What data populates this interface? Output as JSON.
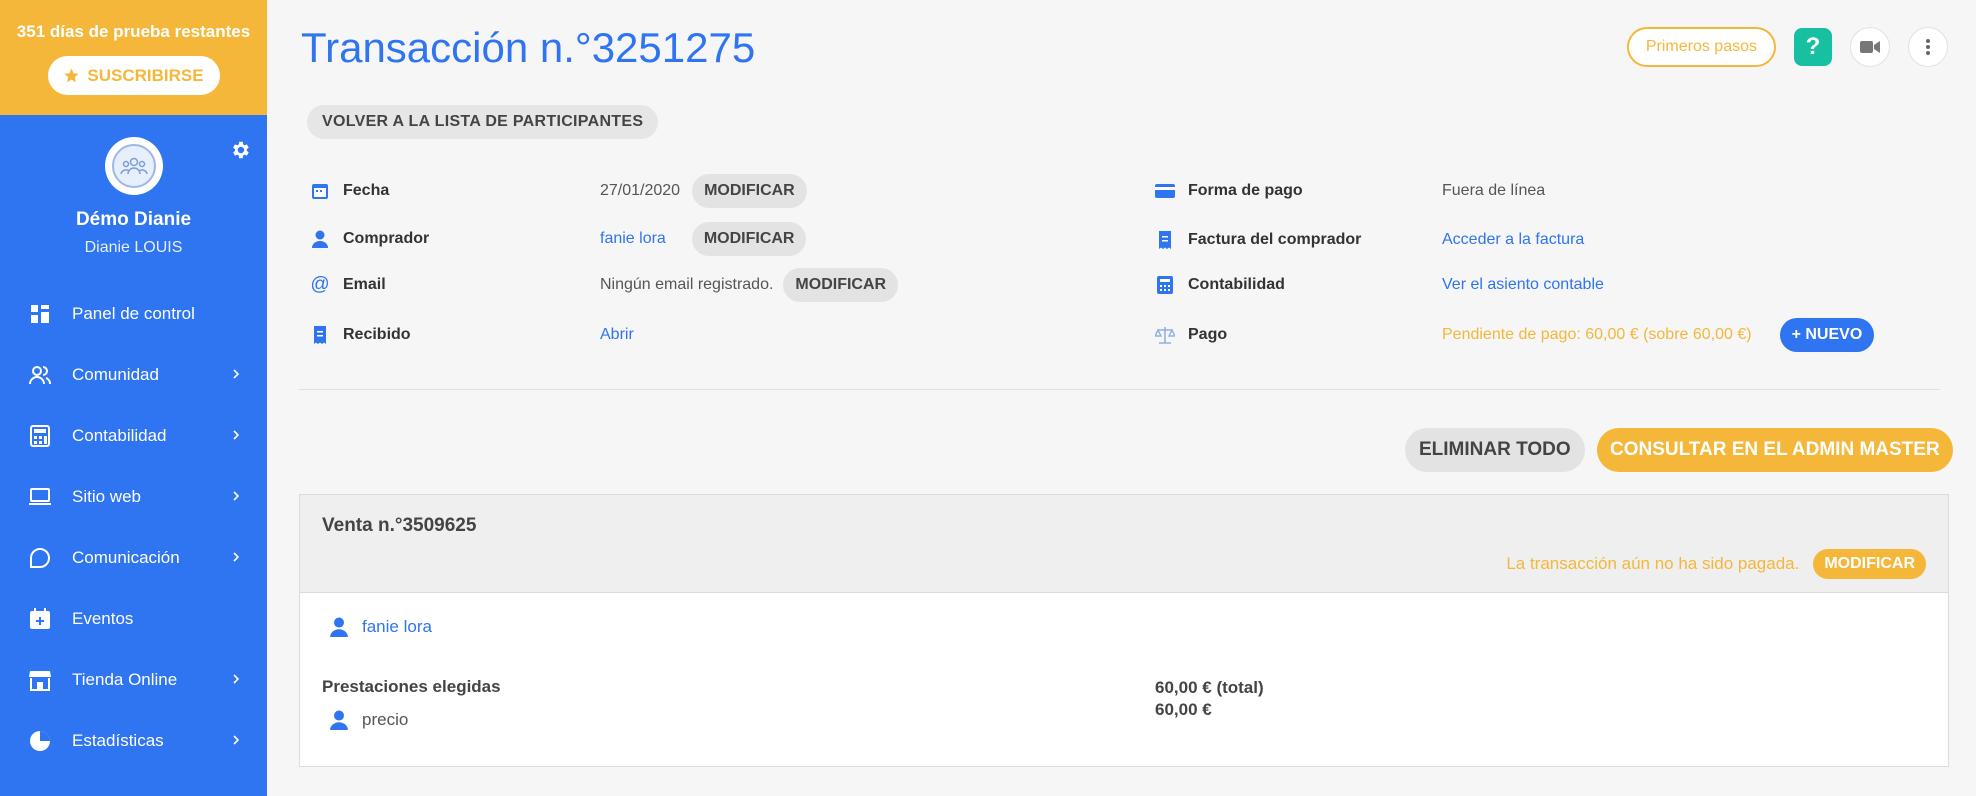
{
  "sidebar": {
    "trial_text": "351 días de prueba restantes",
    "subscribe_label": "SUSCRIBIRSE",
    "profile_name": "Démo Dianie",
    "profile_sub": "Dianie LOUIS",
    "items": [
      {
        "label": "Panel de control",
        "icon": "dashboard-icon"
      },
      {
        "label": "Comunidad",
        "icon": "community-icon"
      },
      {
        "label": "Contabilidad",
        "icon": "calculator-icon"
      },
      {
        "label": "Sitio web",
        "icon": "laptop-icon"
      },
      {
        "label": "Comunicación",
        "icon": "chat-icon"
      },
      {
        "label": "Eventos",
        "icon": "calendar-icon"
      },
      {
        "label": "Tienda Online",
        "icon": "store-icon"
      },
      {
        "label": "Estadísticas",
        "icon": "pie-chart-icon"
      }
    ]
  },
  "header": {
    "title": "Transacción n.°3251275",
    "steps_label": "Primeros pasos",
    "help_label": "?"
  },
  "back_label": "VOLVER A LA LISTA DE PARTICIPANTES",
  "details_left": {
    "date_label": "Fecha",
    "date_value": "27/01/2020",
    "buyer_label": "Comprador",
    "buyer_value": "fanie lora",
    "email_label": "Email",
    "email_value": "Ningún email registrado.",
    "receipt_label": "Recibido",
    "receipt_value": "Abrir",
    "modify_label": "MODIFICAR"
  },
  "details_right": {
    "payment_method_label": "Forma de pago",
    "payment_method_value": "Fuera de línea",
    "invoice_label": "Factura del comprador",
    "invoice_value": "Acceder a la factura",
    "accounting_label": "Contabilidad",
    "accounting_value": "Ver el asiento contable",
    "payment_label": "Pago",
    "payment_value": "Pendiente de pago: 60,00 € (sobre 60,00 €)",
    "new_label": "+ NUEVO"
  },
  "actions": {
    "delete_all": "ELIMINAR TODO",
    "consult": "CONSULTAR EN EL ADMIN MASTER"
  },
  "sale": {
    "title": "Venta n.°3509625",
    "status": "La transacción aún no ha sido pagada.",
    "modify_label": "MODIFICAR",
    "buyer": "fanie lora",
    "services_label": "Prestaciones elegidas",
    "service_item": "precio",
    "total": "60,00 € (total)",
    "item_price": "60,00 €"
  },
  "colors": {
    "primary": "#2f74f0",
    "accent": "#f5b73a",
    "help": "#16c0a0"
  }
}
